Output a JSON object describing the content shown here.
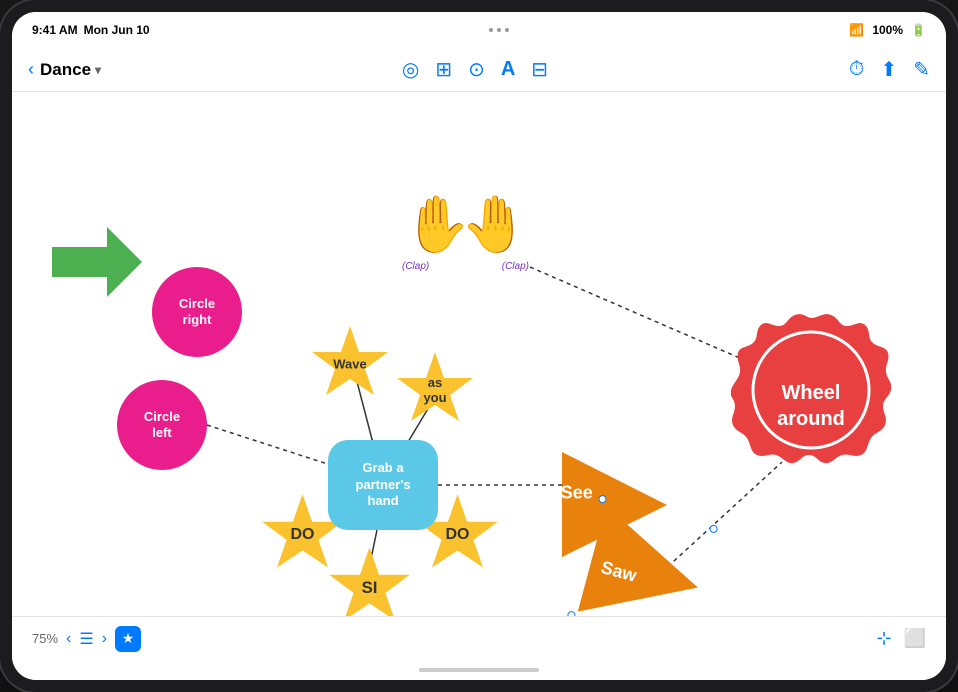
{
  "statusBar": {
    "time": "9:41 AM",
    "date": "Mon Jun 10",
    "dots": [
      "dot1",
      "dot2",
      "dot3"
    ],
    "wifi": "wifi-icon",
    "battery": "100%"
  },
  "toolbar": {
    "backLabel": "Dance",
    "chevron": "chevron-down",
    "icons": {
      "shape": "◎",
      "table": "⊞",
      "folder": "⊡",
      "text": "A",
      "image": "⊟",
      "clock": "⏱",
      "share": "↑",
      "edit": "✎"
    }
  },
  "canvas": {
    "shapes": {
      "circleRight": "Circle\nright",
      "circleLeft": "Circle\nleft",
      "centerNode": "Grab a\npartner's\nhand",
      "wave": "Wave",
      "asYou": "as\nyou",
      "do1": "DO",
      "do2": "DO",
      "si": "SI",
      "wheelAround": "Wheel\naround",
      "see": "See",
      "saw": "Saw",
      "clapLeft": "(Clap)",
      "clapRight": "(Clap)"
    }
  },
  "bottomBar": {
    "zoom": "75%",
    "starIcon": "★"
  }
}
